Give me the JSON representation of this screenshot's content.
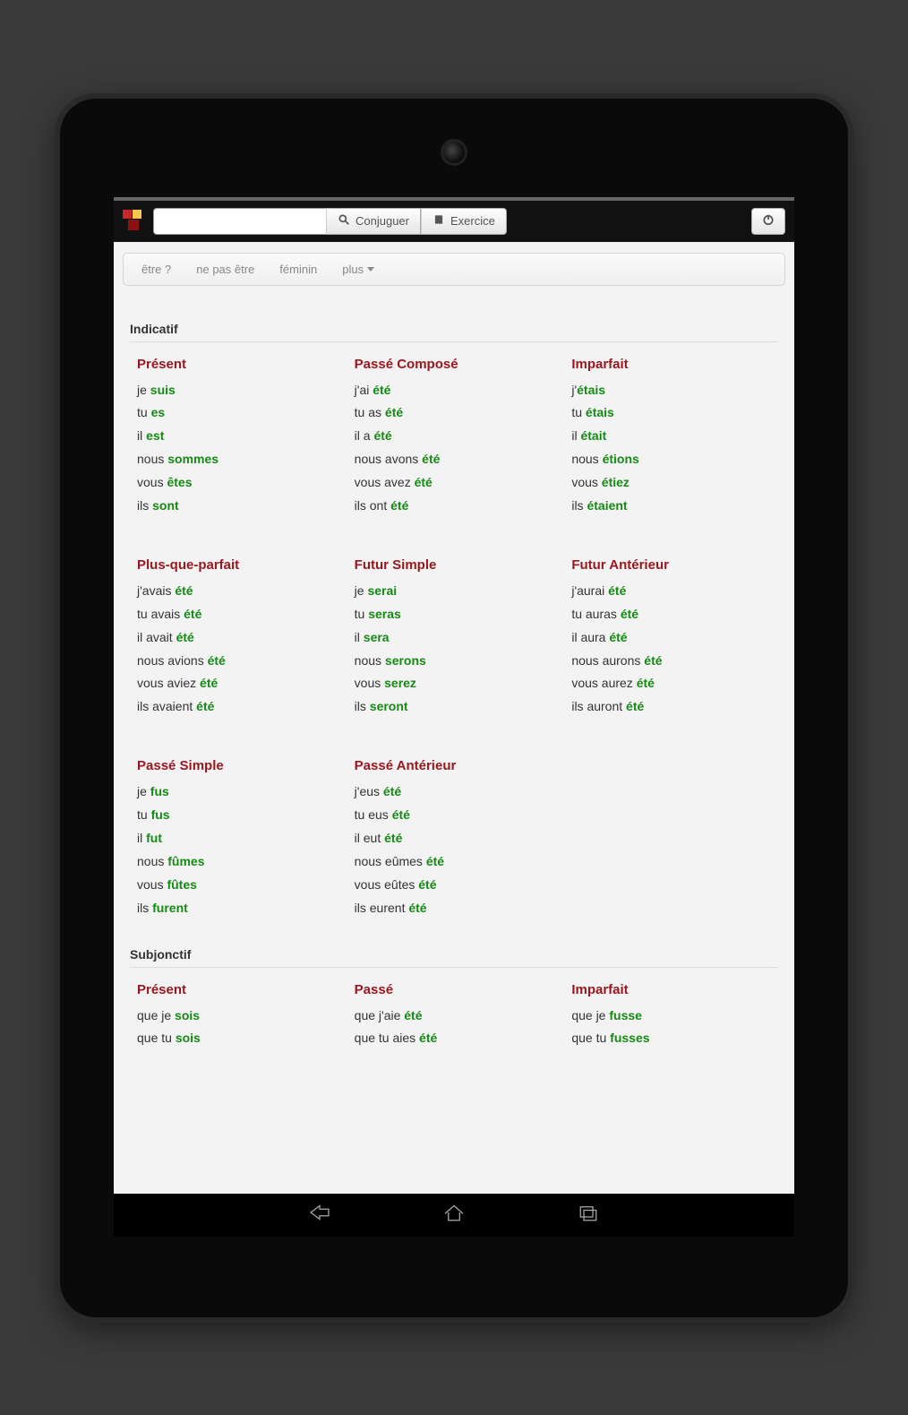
{
  "topbar": {
    "conjugate_label": "Conjuguer",
    "exercise_label": "Exercice",
    "search_value": ""
  },
  "toolbar": {
    "items": [
      {
        "label": "être ?"
      },
      {
        "label": "ne pas être"
      },
      {
        "label": "féminin"
      },
      {
        "label": "plus",
        "dropdown": true
      }
    ]
  },
  "moods": [
    {
      "name": "Indicatif",
      "tenses": [
        {
          "title": "Présent",
          "lines": [
            {
              "pre": "je ",
              "verb": "suis"
            },
            {
              "pre": "tu ",
              "verb": "es"
            },
            {
              "pre": "il ",
              "verb": "est"
            },
            {
              "pre": "nous ",
              "verb": "sommes"
            },
            {
              "pre": "vous ",
              "verb": "êtes"
            },
            {
              "pre": "ils ",
              "verb": "sont"
            }
          ]
        },
        {
          "title": "Passé Composé",
          "lines": [
            {
              "pre": "j'ai ",
              "verb": "été"
            },
            {
              "pre": "tu as ",
              "verb": "été"
            },
            {
              "pre": "il a ",
              "verb": "été"
            },
            {
              "pre": "nous avons ",
              "verb": "été"
            },
            {
              "pre": "vous avez ",
              "verb": "été"
            },
            {
              "pre": "ils ont ",
              "verb": "été"
            }
          ]
        },
        {
          "title": "Imparfait",
          "lines": [
            {
              "pre": "j'",
              "verb": "étais"
            },
            {
              "pre": "tu ",
              "verb": "étais"
            },
            {
              "pre": "il ",
              "verb": "était"
            },
            {
              "pre": "nous ",
              "verb": "étions"
            },
            {
              "pre": "vous ",
              "verb": "étiez"
            },
            {
              "pre": "ils ",
              "verb": "étaient"
            }
          ]
        },
        {
          "title": "Plus-que-parfait",
          "lines": [
            {
              "pre": "j'avais ",
              "verb": "été"
            },
            {
              "pre": "tu avais ",
              "verb": "été"
            },
            {
              "pre": "il avait ",
              "verb": "été"
            },
            {
              "pre": "nous avions ",
              "verb": "été"
            },
            {
              "pre": "vous aviez ",
              "verb": "été"
            },
            {
              "pre": "ils avaient ",
              "verb": "été"
            }
          ]
        },
        {
          "title": "Futur Simple",
          "lines": [
            {
              "pre": "je ",
              "verb": "serai"
            },
            {
              "pre": "tu ",
              "verb": "seras"
            },
            {
              "pre": "il ",
              "verb": "sera"
            },
            {
              "pre": "nous ",
              "verb": "serons"
            },
            {
              "pre": "vous ",
              "verb": "serez"
            },
            {
              "pre": "ils ",
              "verb": "seront"
            }
          ]
        },
        {
          "title": "Futur Antérieur",
          "lines": [
            {
              "pre": "j'aurai ",
              "verb": "été"
            },
            {
              "pre": "tu auras ",
              "verb": "été"
            },
            {
              "pre": "il aura ",
              "verb": "été"
            },
            {
              "pre": "nous aurons ",
              "verb": "été"
            },
            {
              "pre": "vous aurez ",
              "verb": "été"
            },
            {
              "pre": "ils auront ",
              "verb": "été"
            }
          ]
        },
        {
          "title": "Passé Simple",
          "lines": [
            {
              "pre": "je ",
              "verb": "fus"
            },
            {
              "pre": "tu ",
              "verb": "fus"
            },
            {
              "pre": "il ",
              "verb": "fut"
            },
            {
              "pre": "nous ",
              "verb": "fûmes"
            },
            {
              "pre": "vous ",
              "verb": "fûtes"
            },
            {
              "pre": "ils ",
              "verb": "furent"
            }
          ]
        },
        {
          "title": "Passé Antérieur",
          "lines": [
            {
              "pre": "j'eus ",
              "verb": "été"
            },
            {
              "pre": "tu eus ",
              "verb": "été"
            },
            {
              "pre": "il eut ",
              "verb": "été"
            },
            {
              "pre": "nous eûmes ",
              "verb": "été"
            },
            {
              "pre": "vous eûtes ",
              "verb": "été"
            },
            {
              "pre": "ils eurent ",
              "verb": "été"
            }
          ]
        }
      ]
    },
    {
      "name": "Subjonctif",
      "tenses": [
        {
          "title": "Présent",
          "lines": [
            {
              "pre": "que je ",
              "verb": "sois"
            },
            {
              "pre": "que tu ",
              "verb": "sois"
            }
          ]
        },
        {
          "title": "Passé",
          "lines": [
            {
              "pre": "que j'aie ",
              "verb": "été"
            },
            {
              "pre": "que tu aies ",
              "verb": "été"
            }
          ]
        },
        {
          "title": "Imparfait",
          "lines": [
            {
              "pre": "que je ",
              "verb": "fusse"
            },
            {
              "pre": "que tu ",
              "verb": "fusses"
            }
          ]
        }
      ]
    }
  ]
}
